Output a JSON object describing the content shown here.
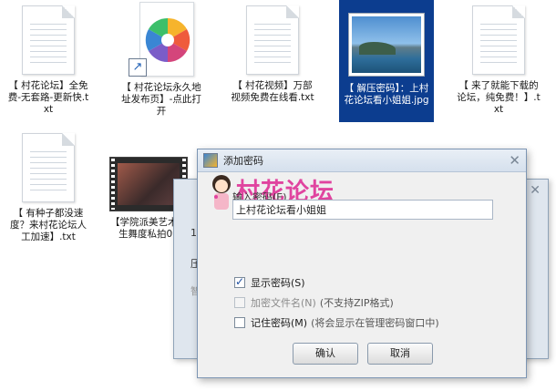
{
  "files": [
    {
      "name": "【 村花论坛】全免费-无套路-更新快.txt",
      "icon": "text-file-icon"
    },
    {
      "name": "【 村花论坛永久地址发布页】-点此打开",
      "icon": "pinwheel-shortcut-icon"
    },
    {
      "name": "【 村花视频】万部视频免费在线看.txt",
      "icon": "text-file-icon"
    },
    {
      "name": "【 解压密码】：上村花论坛看小姐姐.jpg",
      "icon": "image-file-icon",
      "selected": true
    },
    {
      "name": "【 来了就能下载的论坛，纯免费！】.txt",
      "icon": "text-file-icon"
    },
    {
      "name": "【 有种子都没速度？来村花论坛人工加速】.txt",
      "icon": "text-file-icon"
    },
    {
      "name": "【学院派美艺术学生舞度私拍02",
      "icon": "video-file-icon"
    }
  ],
  "back_dialog": {
    "stubs": [
      "1",
      "压",
      "智"
    ]
  },
  "dialog": {
    "title": "添加密码",
    "watermark_text": "村花论坛",
    "field_label": "输入密码(E)",
    "password_value": "上村花论坛看小姐姐",
    "options": [
      {
        "label": "显示密码(S)",
        "checked": true,
        "disabled": false,
        "note": ""
      },
      {
        "label": "加密文件名(N)",
        "checked": false,
        "disabled": true,
        "note": "(不支持ZIP格式)"
      },
      {
        "label": "记住密码(M)",
        "checked": false,
        "disabled": false,
        "note": "(将会显示在管理密码窗口中)"
      }
    ],
    "ok_label": "确认",
    "cancel_label": "取消"
  }
}
